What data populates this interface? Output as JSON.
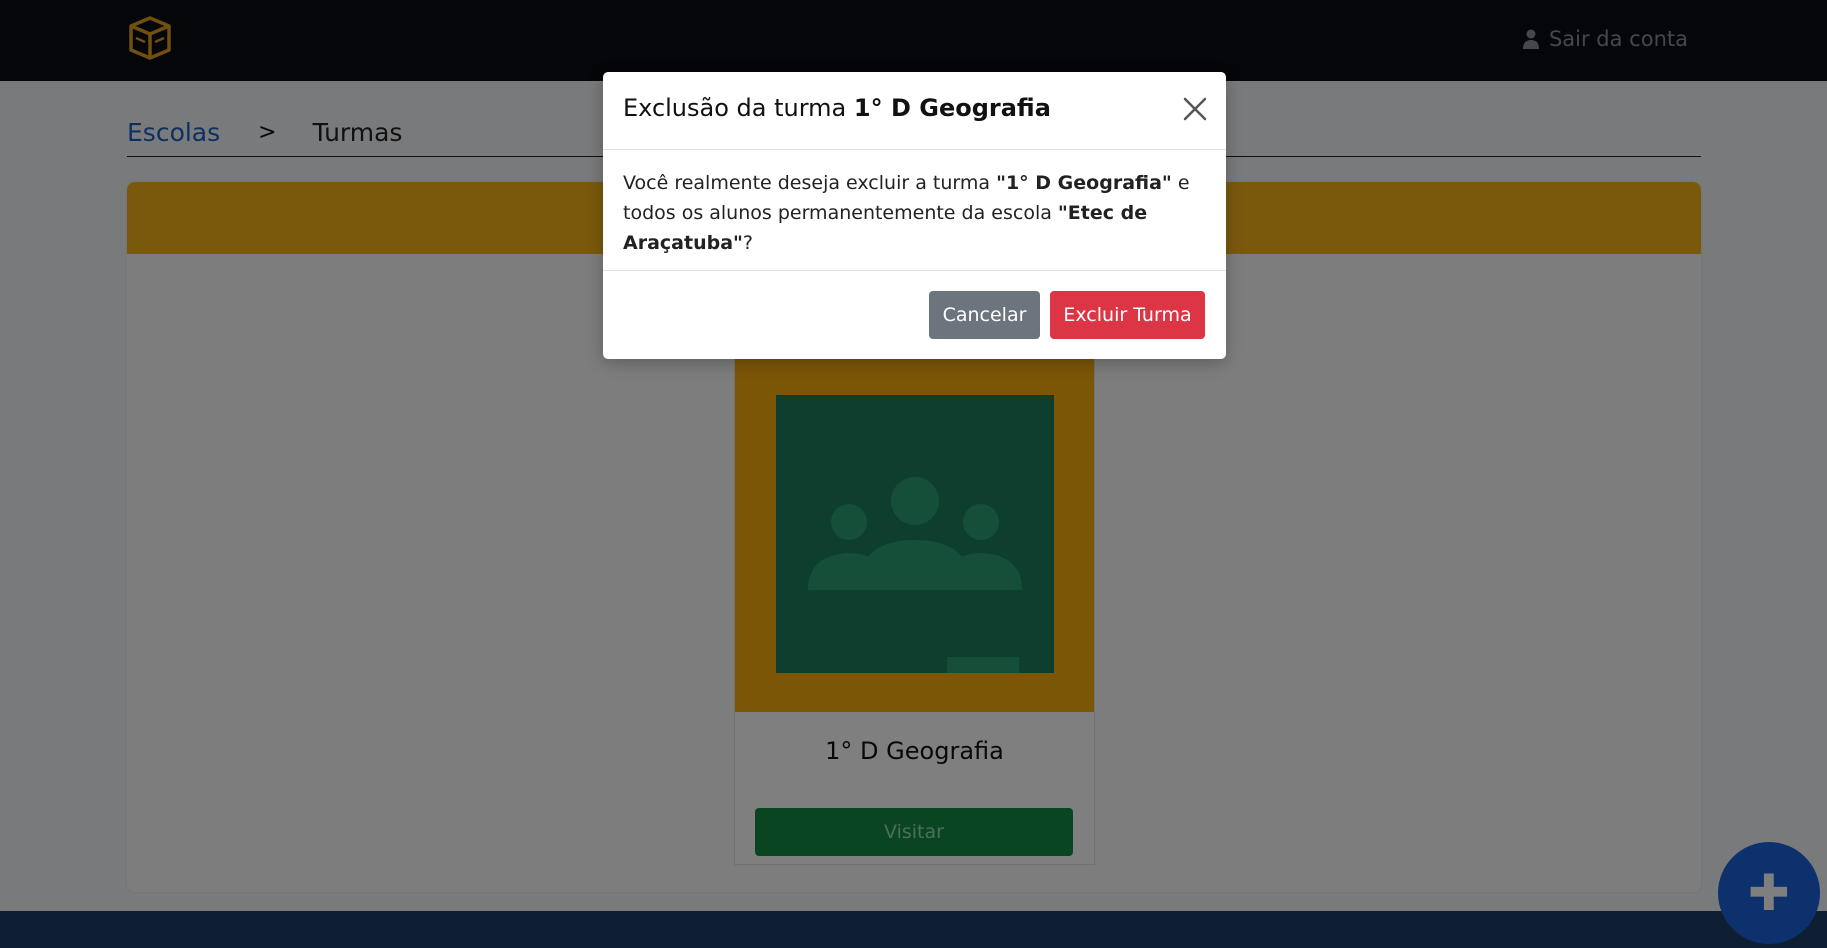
{
  "topbar": {
    "logo_icon": "book-box-icon",
    "logout_icon": "user-icon",
    "logout_label": "Sair da conta"
  },
  "breadcrumb": {
    "schools": "Escolas",
    "separator": ">",
    "current": "Turmas"
  },
  "class_card": {
    "name": "1° D Geografia",
    "visit_label": "Visitar",
    "art_icon": "people-group-icon"
  },
  "fab": {
    "icon": "plus-icon",
    "label": "✚"
  },
  "modal": {
    "title_prefix": "Exclusão da turma ",
    "title_class": "1° D Geografia",
    "body_part1": "Você realmente deseja excluir a turma ",
    "body_class": "\"1° D Geografia\"",
    "body_part2": " e todos os alunos permanentemente da escola ",
    "body_school": "\"Etec de Araçatuba\"",
    "body_end": "?",
    "cancel_label": "Cancelar",
    "delete_label": "Excluir Turma"
  },
  "colors": {
    "accent": "#f5b21a",
    "danger": "#dc3545",
    "secondary": "#6c757d",
    "link": "#1c5fc4",
    "success": "#158a44"
  }
}
